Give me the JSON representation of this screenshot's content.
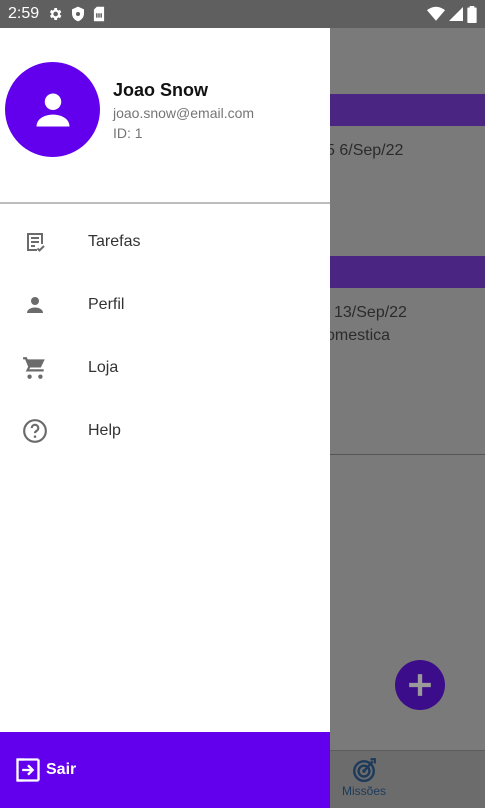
{
  "status_bar": {
    "time": "2:59",
    "icons": [
      "settings-icon",
      "shield-icon",
      "sim-card-icon",
      "wifi-icon",
      "signal-icon",
      "battery-icon"
    ]
  },
  "drawer": {
    "user": {
      "name": "Joao Snow",
      "email": "joao.snow@email.com",
      "id": "ID: 1"
    },
    "menu": [
      {
        "label": "Tarefas",
        "icon": "task-list-icon"
      },
      {
        "label": "Perfil",
        "icon": "person-icon"
      },
      {
        "label": "Loja",
        "icon": "cart-icon"
      },
      {
        "label": "Help",
        "icon": "help-icon"
      }
    ],
    "logout_label": "Sair"
  },
  "background": {
    "card1_date": "5 6/Sep/22",
    "card2_date": "13/Sep/22",
    "card2_category": "omestica",
    "nav_label": "Missões"
  },
  "colors": {
    "primary": "#6200ee",
    "status_bar": "#5f5f5f",
    "scrim_bg": "#7a7a7a"
  }
}
